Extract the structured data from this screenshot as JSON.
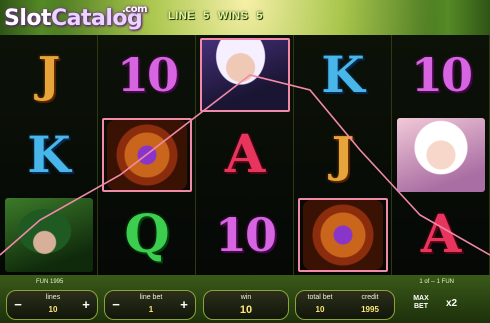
{
  "top_bar": {
    "line_label": "LINE",
    "line_value": "5",
    "wins_label": "WINS",
    "wins_value": "5"
  },
  "watermark": {
    "part1": "Slot",
    "part2": "Catalog",
    "domain": ".com"
  },
  "reels": [
    [
      {
        "type": "letter",
        "text": "J",
        "style": "sym-j"
      },
      {
        "type": "letter",
        "text": "K",
        "style": "sym-k"
      },
      {
        "type": "portrait",
        "icon": "hooded-ranger-icon",
        "style": "p-hood",
        "framed": false
      }
    ],
    [
      {
        "type": "letter",
        "text": "10",
        "style": "sym-10"
      },
      {
        "type": "amulet",
        "icon": "amulet-icon",
        "framed": true
      },
      {
        "type": "letter",
        "text": "Q",
        "style": "sym-q"
      }
    ],
    [
      {
        "type": "portrait",
        "icon": "elf-prince-icon",
        "style": "p-elf",
        "framed": true
      },
      {
        "type": "letter",
        "text": "A",
        "style": "sym-a"
      },
      {
        "type": "letter",
        "text": "10",
        "style": "sym-10"
      }
    ],
    [
      {
        "type": "letter",
        "text": "K",
        "style": "sym-k"
      },
      {
        "type": "letter",
        "text": "J",
        "style": "sym-j"
      },
      {
        "type": "amulet",
        "icon": "amulet-icon",
        "framed": true
      }
    ],
    [
      {
        "type": "letter",
        "text": "10",
        "style": "sym-10"
      },
      {
        "type": "portrait",
        "icon": "elf-queen-icon",
        "style": "p-queen",
        "framed": false
      },
      {
        "type": "letter",
        "text": "A",
        "style": "sym-a"
      }
    ]
  ],
  "strip": {
    "left_text": "FUN 1995",
    "right_text": "1 of -- 1 FUN"
  },
  "controls": {
    "lines_label": "lines",
    "lines_value": "10",
    "line_bet_label": "line bet",
    "line_bet_value": "1",
    "win_label": "win",
    "win_value": "10",
    "total_bet_label": "total bet",
    "total_bet_value": "10",
    "credit_label": "credit",
    "credit_value": "1995",
    "max_bet_label": "MAX BET",
    "speed_label": "x2",
    "minus": "−",
    "plus": "+"
  },
  "colors": {
    "payline": "#f08aa6",
    "panel_border": "#8ba43a",
    "value_text": "#ffe77a"
  }
}
